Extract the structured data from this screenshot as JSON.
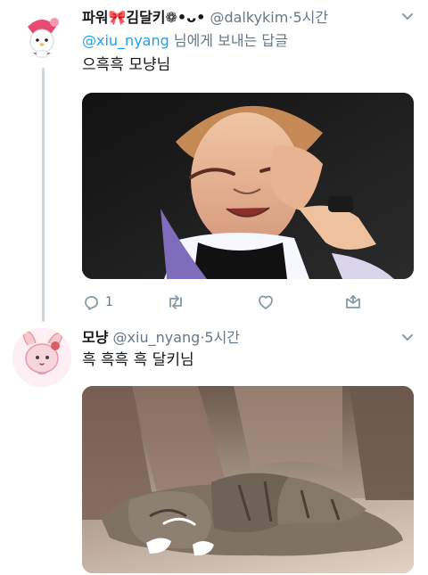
{
  "thread": {
    "tweet_1": {
      "display_name": "파워🎀김달키❁•ᴗ•",
      "handle": "@dalkykim",
      "dot": "·",
      "time": "5시간",
      "reply_to": {
        "mention": "@xiu_nyang",
        "suffix": " 님에게 보내는 답글"
      },
      "text": "으흑흑 모냥님",
      "image_subject": "person-crying-photo",
      "actions": {
        "reply_count": "1",
        "retweet_count": "",
        "like_count": ""
      }
    },
    "tweet_2": {
      "display_name": "모냥",
      "handle": "@xiu_nyang",
      "dot": "·",
      "time": "5시간",
      "text": "흑 흑흑 흑 달키님",
      "image_subject": "cat-face-down-photo"
    }
  },
  "icons": {
    "reply": "reply-icon",
    "retweet": "retweet-icon",
    "like": "heart-icon",
    "dm": "direct-message-icon",
    "more": "chevron-down-icon"
  },
  "colors": {
    "text": "#14171a",
    "secondary": "#657786",
    "link": "#1da1f2",
    "thread_line": "#ccd6dd"
  }
}
